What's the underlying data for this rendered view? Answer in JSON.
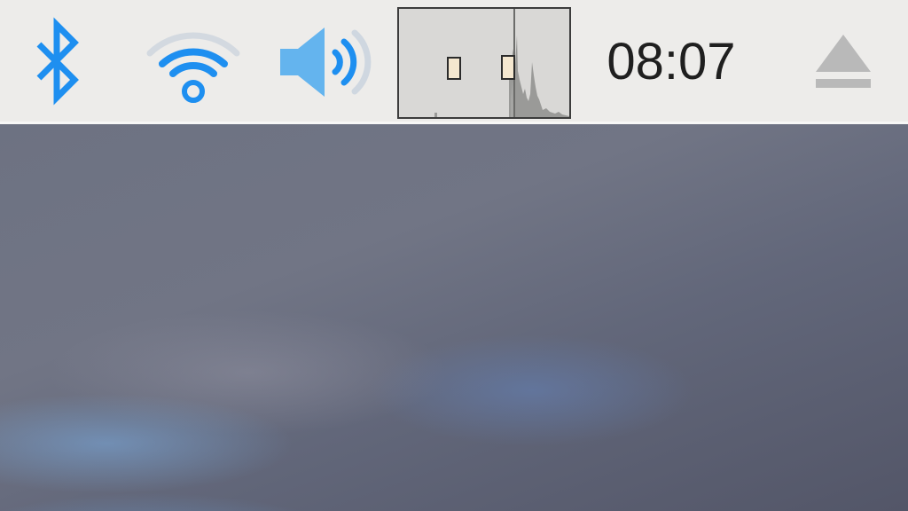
{
  "taskbar": {
    "clock": {
      "time": "08:07"
    },
    "icons": {
      "bluetooth": "bluetooth-icon",
      "wifi": "wifi-icon",
      "volume": "volume-icon",
      "cpu_monitor": "cpu-monitor-icon",
      "eject": "eject-icon"
    },
    "colors": {
      "panel_background": "#edecea",
      "icon_blue": "#1e8ff0",
      "clock_text": "#1f1f1f",
      "eject_gray": "#b9b9b9",
      "cpu_border": "#3c3c3c",
      "cpu_background": "#d9d8d6"
    }
  }
}
